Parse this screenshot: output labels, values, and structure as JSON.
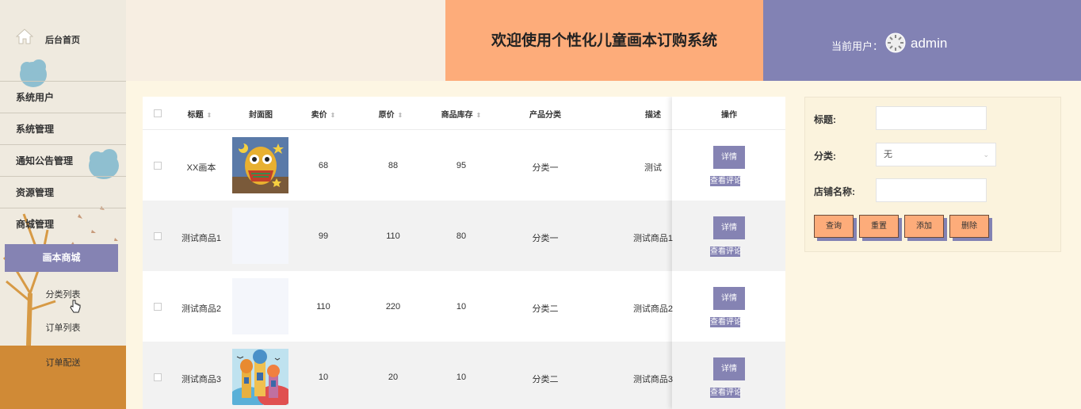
{
  "sidebar": {
    "home_label": "后台首页",
    "menu": [
      {
        "label": "系统用户"
      },
      {
        "label": "系统管理"
      },
      {
        "label": "通知公告管理"
      },
      {
        "label": "资源管理"
      },
      {
        "label": "商城管理"
      }
    ],
    "active_sub": "画本商城",
    "sub_items": [
      {
        "label": "分类列表"
      },
      {
        "label": "订单列表"
      }
    ],
    "bottom_item": "订单配送"
  },
  "header": {
    "title": "欢迎使用个性化儿童画本订购系统",
    "user_label": "当前用户：",
    "user_name": "admin"
  },
  "table": {
    "headers": {
      "title": "标题",
      "cover": "封面图",
      "price": "卖价",
      "original_price": "原价",
      "stock": "商品库存",
      "category": "产品分类",
      "desc": "描述",
      "ops": "操作"
    },
    "rows": [
      {
        "title": "XX画本",
        "price": "68",
        "original_price": "88",
        "stock": "95",
        "category": "分类一",
        "desc": "测试"
      },
      {
        "title": "测试商品1",
        "price": "99",
        "original_price": "110",
        "stock": "80",
        "category": "分类一",
        "desc": "测试商品1"
      },
      {
        "title": "测试商品2",
        "price": "110",
        "original_price": "220",
        "stock": "10",
        "category": "分类二",
        "desc": "测试商品2"
      },
      {
        "title": "测试商品3",
        "price": "10",
        "original_price": "20",
        "stock": "10",
        "category": "分类二",
        "desc": "测试商品3"
      }
    ],
    "detail_label": "详情",
    "comment_label": "查看评论"
  },
  "search": {
    "title_label": "标题:",
    "category_label": "分类:",
    "category_value": "无",
    "shop_label": "店铺名称:",
    "buttons": {
      "query": "查询",
      "reset": "重置",
      "add": "添加",
      "delete": "删除"
    }
  },
  "colors": {
    "accent_purple": "#8583b3",
    "accent_orange": "#fdac7a",
    "sidebar_bottom": "#d08a36"
  }
}
